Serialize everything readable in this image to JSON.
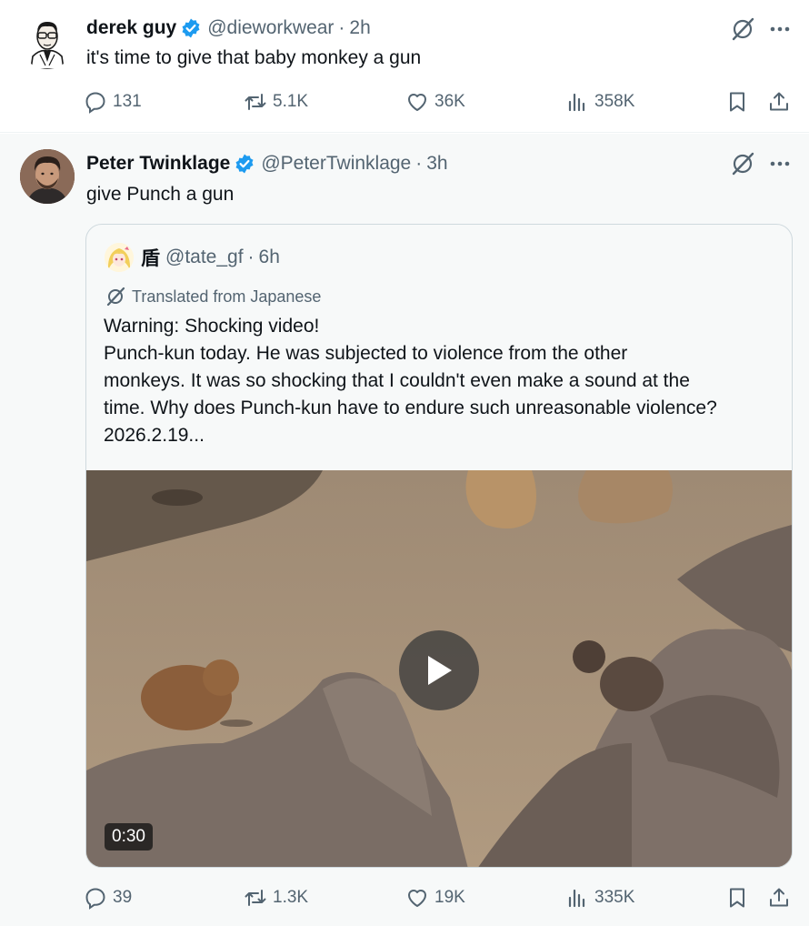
{
  "colors": {
    "text_primary": "#0f1419",
    "text_secondary": "#536471",
    "verified_blue": "#1d9bf0",
    "border": "#cfd9de"
  },
  "tweets": [
    {
      "author": {
        "name": "derek guy",
        "handle": "@dieworkwear",
        "verified": true
      },
      "time": "2h",
      "text": "it's time to give that baby monkey a gun",
      "stats": {
        "replies": "131",
        "reposts": "5.1K",
        "likes": "36K",
        "views": "358K"
      }
    },
    {
      "author": {
        "name": "Peter Twinklage",
        "handle": "@PeterTwinklage",
        "verified": true
      },
      "time": "3h",
      "text": "give Punch a gun",
      "quote": {
        "author": {
          "name": "盾",
          "handle": "@tate_gf"
        },
        "time": "6h",
        "translated_label": "Translated from Japanese",
        "lines": [
          "Warning: Shocking video!",
          "Punch-kun today. He was subjected to violence from the other",
          "monkeys. It was so shocking that I couldn't even make a sound at the",
          "time. Why does Punch-kun have to endure such unreasonable violence?",
          "2026.2.19..."
        ],
        "video": {
          "duration": "0:30"
        }
      },
      "stats": {
        "replies": "39",
        "reposts": "1.3K",
        "likes": "19K",
        "views": "335K"
      }
    }
  ],
  "icons": {
    "reply": "reply-icon",
    "repost": "repost-icon",
    "like": "heart-icon",
    "views": "views-icon",
    "bookmark": "bookmark-icon",
    "share": "share-icon",
    "grok": "grok-icon",
    "more": "more-icon",
    "verified": "verified-badge-icon",
    "play": "play-icon"
  }
}
